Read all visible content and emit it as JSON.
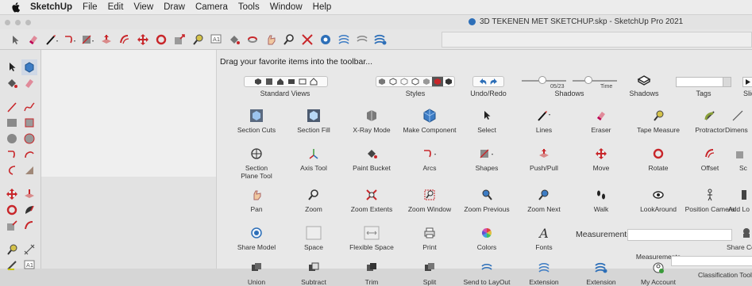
{
  "menubar": {
    "app": "SketchUp",
    "items": [
      "File",
      "Edit",
      "View",
      "Draw",
      "Camera",
      "Tools",
      "Window",
      "Help"
    ]
  },
  "window": {
    "title": "3D TEKENEN MET SKETCHUP.skp - SketchUp Pro 2021"
  },
  "sheet": {
    "hint": "Drag your favorite items into the toolbar...",
    "groups": {
      "standard_views": "Standard Views",
      "styles": "Styles",
      "undo_redo": "Undo/Redo",
      "shadows_slider": "Shadows",
      "shadows": "Shadows",
      "tags": "Tags",
      "slides": "Slid"
    },
    "slider": {
      "date": "05/23",
      "time": "Time"
    },
    "row1": [
      "Section Cuts",
      "Section Fill",
      "X-Ray Mode",
      "Make Component",
      "Select",
      "Lines",
      "Eraser",
      "Tape Measure",
      "Protractor",
      "Dimens"
    ],
    "row2": [
      "Section\nPlane Tool",
      "Axis Tool",
      "Paint Bucket",
      "Arcs",
      "Shapes",
      "Push/Pull",
      "Move",
      "Rotate",
      "Offset",
      "Sc"
    ],
    "row3": [
      "Pan",
      "Zoom",
      "Zoom Extents",
      "Zoom Window",
      "Zoom Previous",
      "Zoom Next",
      "Walk",
      "LookAround",
      "Position Camera",
      "Add Lo"
    ],
    "row4": [
      "Share Model",
      "Space",
      "Flexible Space",
      "Print",
      "Colors",
      "Fonts",
      "Measurements",
      "",
      "Share Co"
    ],
    "measurements_label": "Measurements",
    "row5": [
      "Union",
      "Subtract",
      "Trim",
      "Split",
      "Send to LayOut",
      "Extension",
      "Extension",
      "My Account",
      "Classification Toolbar"
    ]
  },
  "colors": {
    "accent": "#2d6fb8",
    "red": "#c8262a"
  }
}
